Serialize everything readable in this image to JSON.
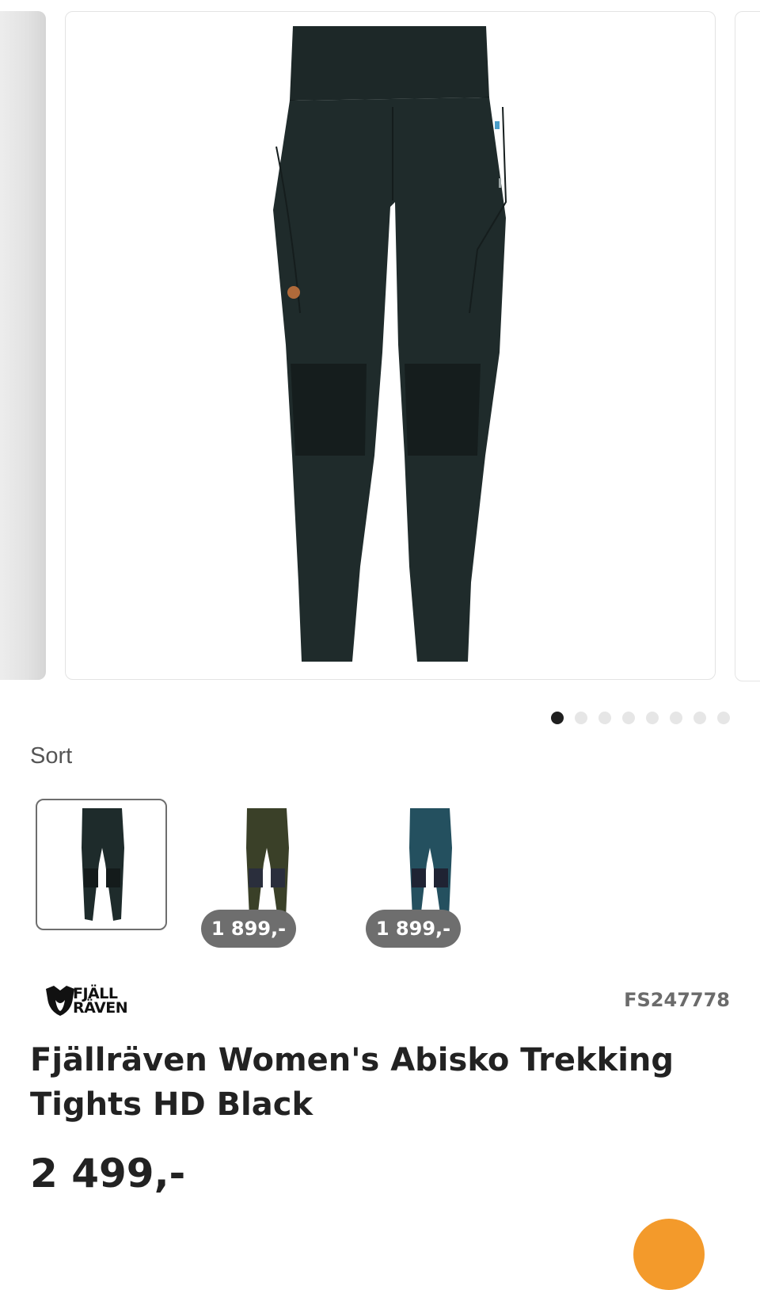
{
  "gallery": {
    "image_label": "Fjällräven Women's Abisko Trekking Tights HD Black",
    "dot_count": 8,
    "active_index": 0
  },
  "color": {
    "label": "Sort"
  },
  "variants": [
    {
      "name": "black",
      "color": "#1e2b2b",
      "price": "",
      "selected": true
    },
    {
      "name": "deep-forest",
      "color": "#3a4028",
      "price": "1 899,-",
      "selected": false
    },
    {
      "name": "indigo-blue",
      "color": "#24505f",
      "price": "1 899,-",
      "selected": false
    }
  ],
  "brand": {
    "line1": "FJÄLL",
    "line2": "RÄVEN",
    "icon": "fox-logo-icon"
  },
  "product": {
    "sku": "FS247778",
    "title": "Fjällräven Women's Abisko Trekking Tights HD Black",
    "price": "2 499,-"
  },
  "colors": {
    "pill": "#6e6e6e",
    "accent": "#f39a2b"
  }
}
